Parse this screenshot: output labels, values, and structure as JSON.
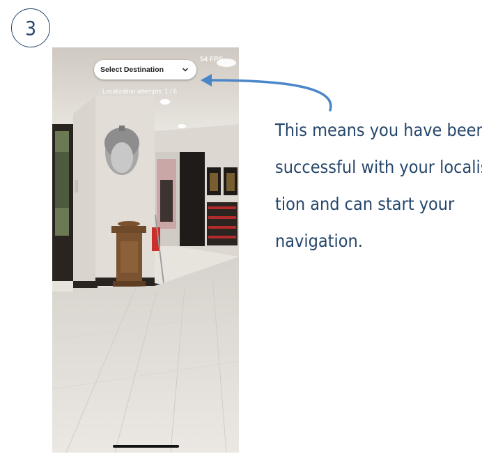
{
  "step": {
    "number": "3"
  },
  "phone": {
    "fps": "54 FPS",
    "select": {
      "label": "Select Destination",
      "icon": "chevron-down-icon"
    },
    "localization": "Localization attempts:  1 / 6"
  },
  "explanation": {
    "lines": [
      "This means you have been",
      "successful with your localisa-",
      "tion and can start your",
      "navigation."
    ]
  },
  "colors": {
    "accent": "#25466b",
    "arrow": "#4a86c8"
  }
}
